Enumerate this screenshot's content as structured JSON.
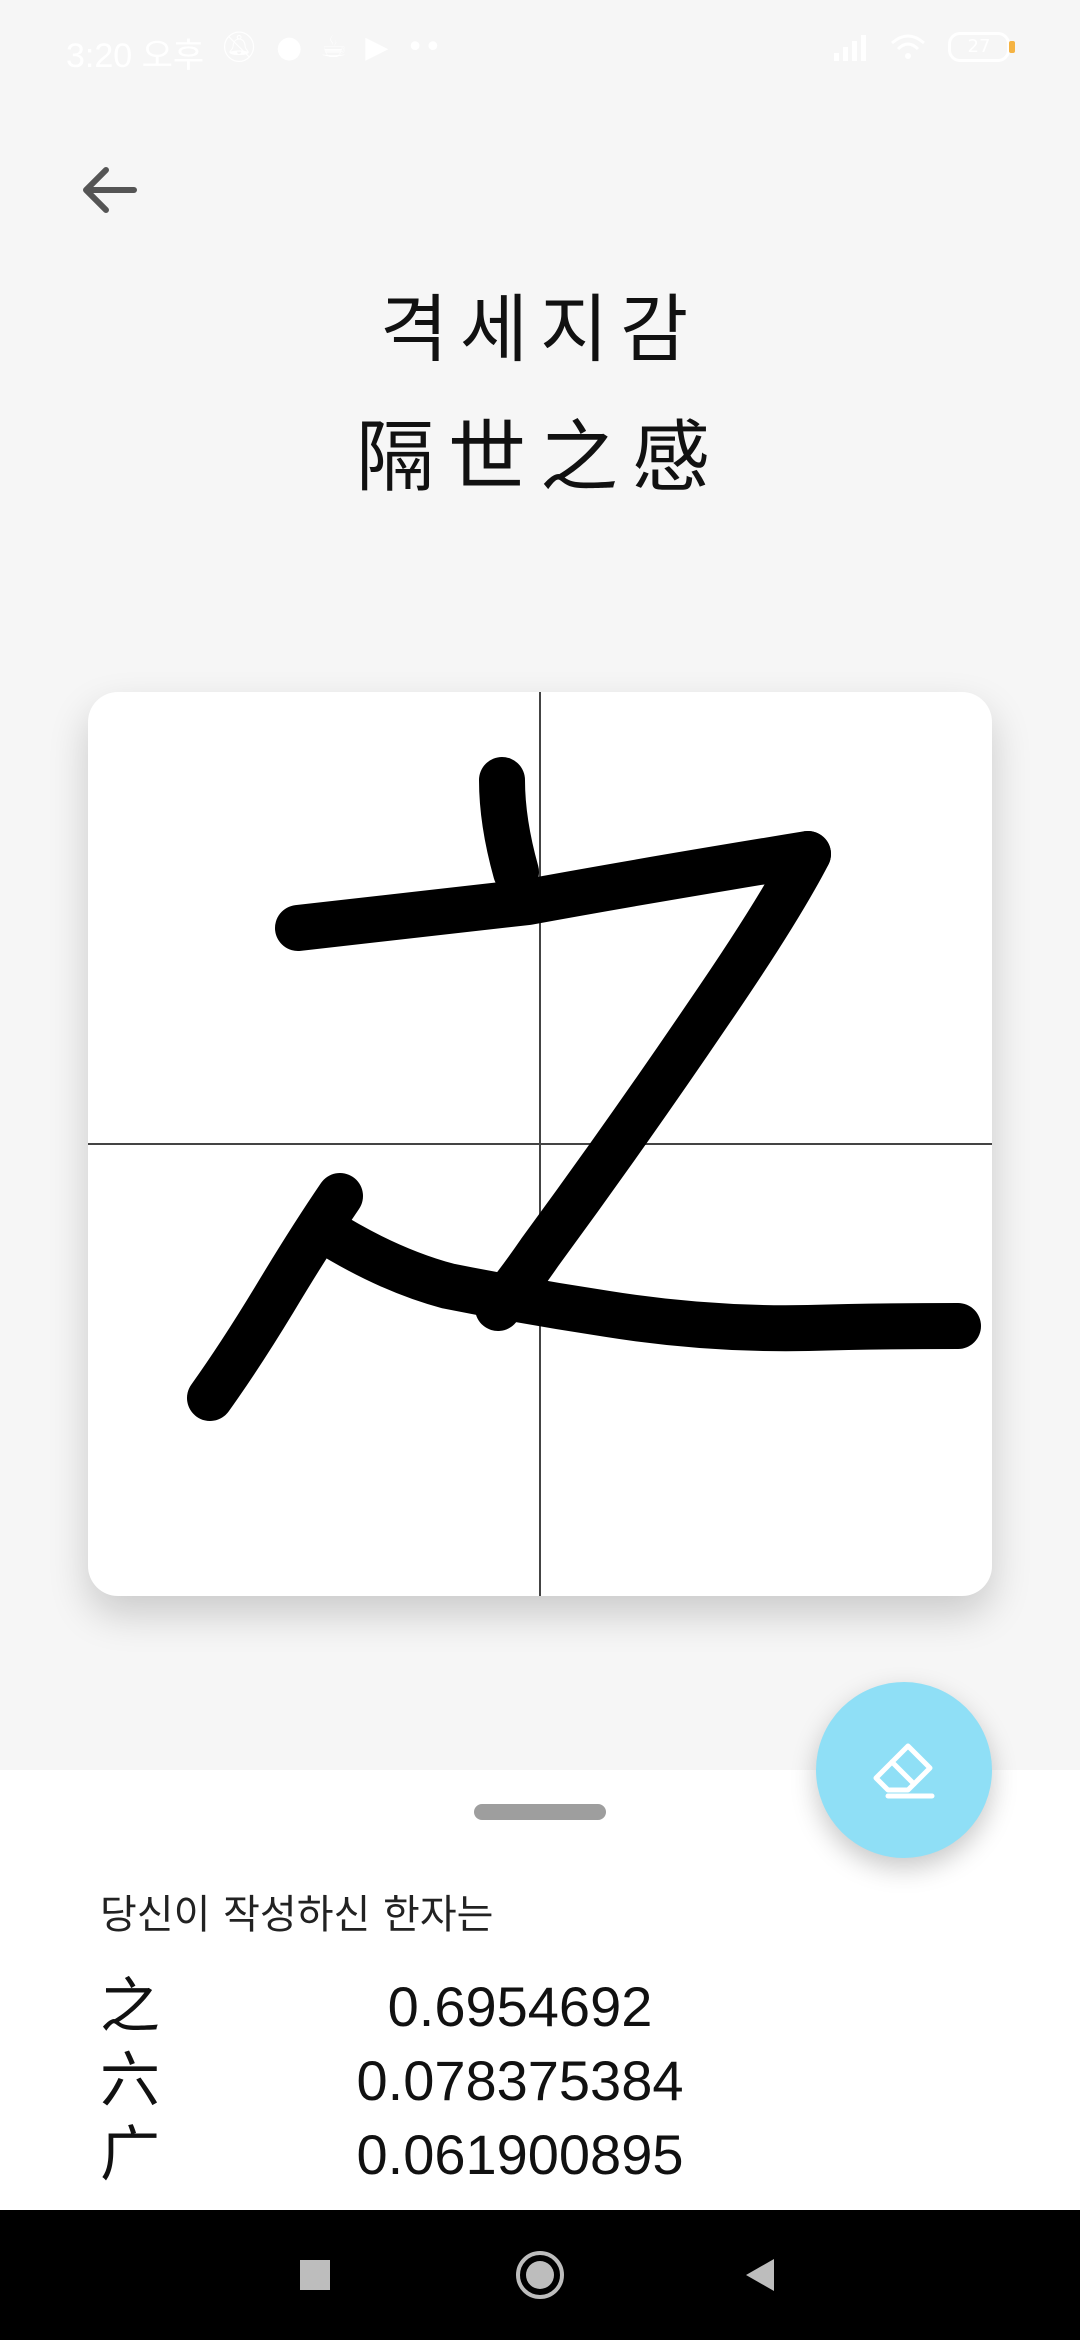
{
  "status_bar": {
    "time": "3:20 오후",
    "battery_level": "27",
    "left_icons": [
      "mute-icon",
      "chat-icon",
      "coffee-icon",
      "megaphone-icon",
      "more-dots-icon"
    ],
    "right_icons": [
      "signal-icon",
      "wifi-icon",
      "battery-icon"
    ]
  },
  "header": {
    "title_korean": "격세지감",
    "title_hanja": "隔世之感"
  },
  "canvas": {
    "background": "#ffffff",
    "guide_line_color": "#444444",
    "stroke_color": "#000000"
  },
  "eraser_button": {
    "icon": "eraser-icon",
    "color": "#8fdff6"
  },
  "results": {
    "heading": "당신이 작성하신 한자는",
    "items": [
      {
        "char": "之",
        "score": "0.6954692"
      },
      {
        "char": "六",
        "score": "0.078375384"
      },
      {
        "char": "广",
        "score": "0.061900895"
      }
    ]
  },
  "nav_bar": {
    "icons": [
      "recent-apps-icon",
      "home-icon",
      "back-triangle-icon"
    ]
  }
}
